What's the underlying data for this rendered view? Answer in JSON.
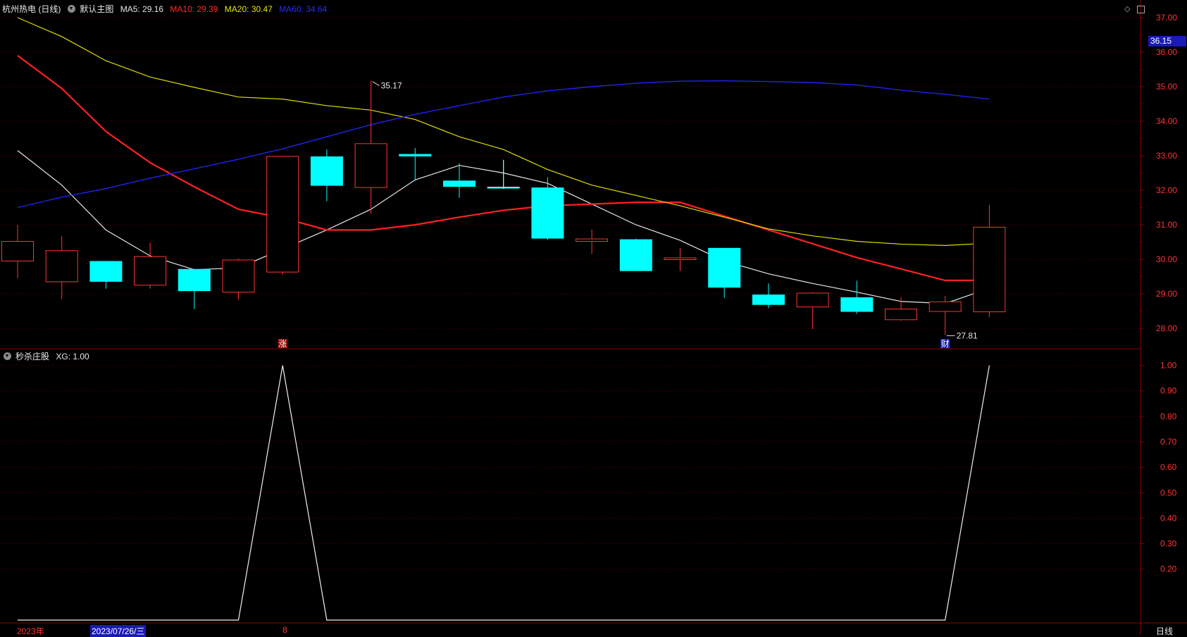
{
  "header": {
    "stock": "杭州热电 (日线)",
    "template": "默认主图",
    "ma": [
      {
        "label": "MA5: 29.16",
        "color": "#e6e6e6"
      },
      {
        "label": "MA10: 29.39",
        "color": "#ff2a2a"
      },
      {
        "label": "MA20: 30.47",
        "color": "#e6e600"
      },
      {
        "label": "MA60: 34.64",
        "color": "#2a2aff"
      }
    ],
    "icons": [
      "diamond-icon",
      "window-restore-icon"
    ]
  },
  "indicator_header": {
    "name": "秒杀庄股",
    "value": "XG: 1.00"
  },
  "current_price_tag": "36.15",
  "annotations": {
    "high_label": "35.17",
    "low_label": "27.81",
    "marker_zhang": "涨",
    "marker_cai": "财"
  },
  "bottom_bar": {
    "year": "2023年",
    "date": "2023/07/26/三",
    "month_mark": "8",
    "period": "日线"
  },
  "colors": {
    "up": "#ff3333",
    "down": "#00ffff",
    "ma5": "#e6e6e6",
    "ma10": "#ff2020",
    "ma20": "#dddd00",
    "ma60": "#2222ee",
    "grid": "#5a0000",
    "axis_text": "#ff3333"
  },
  "chart_data": [
    {
      "type": "candlestick",
      "y_ticks": [
        "37.00",
        "36.00",
        "35.00",
        "34.00",
        "33.00",
        "32.00",
        "31.00",
        "30.00",
        "29.00",
        "28.00"
      ],
      "ylim": [
        27.35,
        37.45
      ],
      "candles": [
        {
          "open": 29.95,
          "close": 30.52,
          "high": 31.0,
          "low": 29.45
        },
        {
          "open": 29.35,
          "close": 30.25,
          "high": 30.68,
          "low": 28.85
        },
        {
          "open": 29.95,
          "close": 29.35,
          "high": 29.95,
          "low": 29.15
        },
        {
          "open": 29.25,
          "close": 30.08,
          "high": 30.48,
          "low": 29.15
        },
        {
          "open": 29.72,
          "close": 29.08,
          "high": 29.72,
          "low": 28.56
        },
        {
          "open": 29.05,
          "close": 29.98,
          "high": 30.02,
          "low": 28.84
        },
        {
          "open": 29.63,
          "close": 32.98,
          "high": 32.98,
          "low": 29.55
        },
        {
          "open": 32.98,
          "close": 32.13,
          "high": 33.18,
          "low": 31.68
        },
        {
          "open": 32.08,
          "close": 33.35,
          "high": 35.17,
          "low": 31.32
        },
        {
          "open": 33.05,
          "close": 32.98,
          "high": 33.22,
          "low": 32.28
        },
        {
          "open": 32.28,
          "close": 32.1,
          "high": 32.78,
          "low": 31.78
        },
        {
          "open": 32.09,
          "close": 32.08,
          "high": 32.88,
          "low": 32.04
        },
        {
          "open": 32.08,
          "close": 30.6,
          "high": 32.38,
          "low": 30.56
        },
        {
          "open": 30.52,
          "close": 30.59,
          "high": 30.86,
          "low": 30.15
        },
        {
          "open": 30.58,
          "close": 29.66,
          "high": 30.6,
          "low": 29.66
        },
        {
          "open": 29.99,
          "close": 30.04,
          "high": 30.33,
          "low": 29.66
        },
        {
          "open": 30.33,
          "close": 29.18,
          "high": 30.33,
          "low": 28.88
        },
        {
          "open": 28.98,
          "close": 28.68,
          "high": 29.3,
          "low": 28.58
        },
        {
          "open": 28.62,
          "close": 29.02,
          "high": 29.05,
          "low": 27.98
        },
        {
          "open": 28.9,
          "close": 28.48,
          "high": 29.38,
          "low": 28.42
        },
        {
          "open": 28.25,
          "close": 28.56,
          "high": 28.9,
          "low": 28.22
        },
        {
          "open": 28.49,
          "close": 28.77,
          "high": 28.94,
          "low": 27.81
        },
        {
          "open": 28.48,
          "close": 30.93,
          "high": 31.58,
          "low": 28.33
        }
      ],
      "ma_series": [
        {
          "name": "MA5",
          "values": [
            33.15,
            32.15,
            30.85,
            30.1,
            29.7,
            29.75,
            30.3,
            30.85,
            31.45,
            32.3,
            32.72,
            32.5,
            32.2,
            31.6,
            31.0,
            30.55,
            29.95,
            29.58,
            29.3,
            29.05,
            28.78,
            28.72,
            29.16
          ]
        },
        {
          "name": "MA10",
          "values": [
            35.9,
            34.95,
            33.7,
            32.8,
            32.1,
            31.45,
            31.2,
            30.85,
            30.85,
            31.0,
            31.22,
            31.42,
            31.55,
            31.6,
            31.65,
            31.65,
            31.25,
            30.85,
            30.45,
            30.05,
            29.72,
            29.39,
            29.39
          ]
        },
        {
          "name": "MA20",
          "values": [
            37.0,
            36.45,
            35.75,
            35.28,
            34.98,
            34.7,
            34.64,
            34.45,
            34.32,
            34.05,
            33.55,
            33.18,
            32.6,
            32.15,
            31.85,
            31.55,
            31.22,
            30.88,
            30.68,
            30.52,
            30.44,
            30.4,
            30.47
          ]
        },
        {
          "name": "MA60",
          "values": [
            31.5,
            31.8,
            32.05,
            32.35,
            32.62,
            32.9,
            33.2,
            33.55,
            33.9,
            34.2,
            34.45,
            34.7,
            34.88,
            35.0,
            35.1,
            35.16,
            35.17,
            35.15,
            35.12,
            35.05,
            34.9,
            34.78,
            34.64
          ]
        }
      ]
    },
    {
      "type": "line",
      "name": "XG",
      "y_ticks": [
        "1.00",
        "0.90",
        "0.80",
        "0.70",
        "0.60",
        "0.50",
        "0.40",
        "0.30",
        "0.20"
      ],
      "ylim": [
        0,
        1.0
      ],
      "values": [
        0,
        0,
        0,
        0,
        0,
        0,
        1,
        0,
        0,
        0,
        0,
        0,
        0,
        0,
        0,
        0,
        0,
        0,
        0,
        0,
        0,
        0,
        1
      ]
    }
  ]
}
